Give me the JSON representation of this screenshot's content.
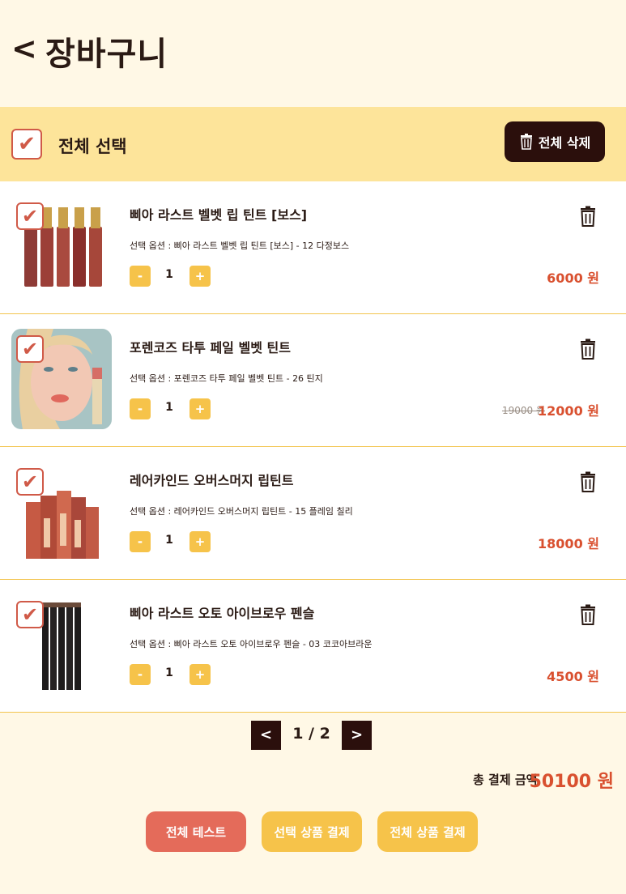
{
  "header": {
    "back_icon": "<",
    "title": "장바구니"
  },
  "select_bar": {
    "check_mark": "✔",
    "label": "전체 선택",
    "delete_all_label": "전체 삭제"
  },
  "items": [
    {
      "name": "삐아 라스트 벨벳 립 틴트 [보스]",
      "option": "선택 옵션 : 삐아 라스트 벨벳 립 틴트 [보스] - 12 다정보스",
      "quantity": "1",
      "original_price": "",
      "price": "6000 원",
      "checked": "✔"
    },
    {
      "name": "포렌코즈 타투 페일 벨벳 틴트",
      "option": "선택 옵션 : 포렌코즈 타투 페일 벨벳 틴트 - 26 틴지",
      "quantity": "1",
      "original_price": "19000 원",
      "price": "12000 원",
      "checked": "✔"
    },
    {
      "name": "레어카인드 오버스머지 립틴트",
      "option": "선택 옵션 : 레어카인드 오버스머지 립틴트 - 15 플레임 칠리",
      "quantity": "1",
      "original_price": "",
      "price": "18000 원",
      "checked": "✔"
    },
    {
      "name": "삐아 라스트 오토 아이브로우 펜슬",
      "option": "선택 옵션 : 삐아 라스트 오토 아이브로우 펜슬 - 03 코코아브라운",
      "quantity": "1",
      "original_price": "",
      "price": "4500 원",
      "checked": "✔"
    }
  ],
  "qty_controls": {
    "minus": "-",
    "plus": "+"
  },
  "pagination": {
    "prev": "<",
    "next": ">",
    "indicator": "1 / 2"
  },
  "total": {
    "label": "총 결제 금액",
    "amount": "50100 원"
  },
  "actions": {
    "test_all": "전체 테스트",
    "pay_selected": "선택 상품 결제",
    "pay_all": "전체 상품 결제"
  },
  "colors": {
    "accent": "#d9502f",
    "button_yellow": "#f6c34a",
    "dark": "#2b0f0c",
    "bar": "#fde49a",
    "background": "#fff8e6"
  }
}
